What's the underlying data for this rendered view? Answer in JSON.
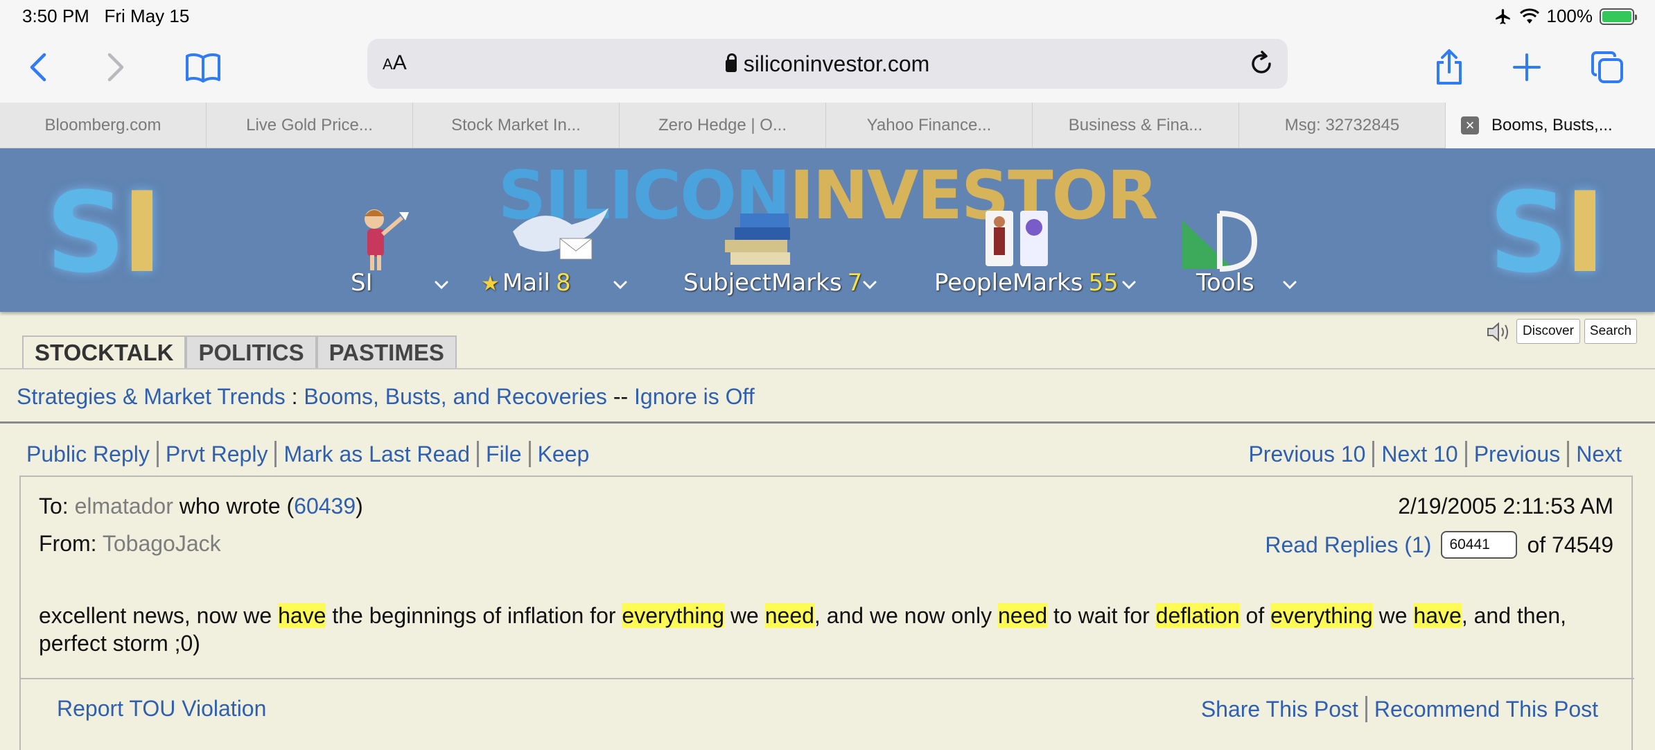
{
  "status_bar": {
    "time": "3:50 PM",
    "date": "Fri May 15",
    "battery": "100%"
  },
  "browser": {
    "url": "siliconinvestor.com",
    "reader_label_small": "A",
    "reader_label_large": "A",
    "tabs": [
      "Bloomberg.com",
      "Live Gold Price...",
      "Stock Market In...",
      "Zero Hedge | O...",
      "Yahoo Finance...",
      "Business & Fina...",
      "Msg: 32732845",
      "Booms, Busts,..."
    ]
  },
  "banner": {
    "logo_s": "S",
    "logo_i": "I",
    "brand_part1": "SILICON",
    "brand_part2": "INVESTOR",
    "menu": {
      "si": "SI",
      "mail": "Mail",
      "mail_count": "8",
      "subjectmarks": "SubjectMarks",
      "subjectmarks_count": "7",
      "peoplemarks": "PeopleMarks",
      "peoplemarks_count": "55",
      "tools": "Tools"
    }
  },
  "utility": {
    "discover": "Discover",
    "search": "Search"
  },
  "sections": {
    "stocktalk": "STOCKTALK",
    "politics": "POLITICS",
    "pastimes": "PASTIMES"
  },
  "breadcrumb": {
    "parent": "Strategies & Market Trends",
    "colon": " : ",
    "thread": "Booms, Busts, and Recoveries",
    "dash": " -- ",
    "ignore": "Ignore is Off"
  },
  "actions": {
    "public_reply": "Public Reply",
    "private_reply": "Prvt Reply",
    "mark_last_read": "Mark as Last Read",
    "file": "File",
    "keep": "Keep",
    "prev10": "Previous 10",
    "next10": "Next 10",
    "previous": "Previous",
    "next": "Next"
  },
  "message": {
    "to_label": "To:",
    "to_user": "elmatador",
    "wrote_label": " who wrote (",
    "ref_msg": "60439",
    "close_paren": ")",
    "from_label": "From:",
    "from_user": "TobagoJack",
    "date": "2/19/2005 2:11:53 AM",
    "read_replies": "Read Replies (1)",
    "msg_number": "60441",
    "of_total": "of 74549",
    "body": [
      {
        "t": "excellent news, now we ",
        "h": false
      },
      {
        "t": "have",
        "h": true
      },
      {
        "t": " the beginnings of inflation for ",
        "h": false
      },
      {
        "t": "everything",
        "h": true
      },
      {
        "t": " we ",
        "h": false
      },
      {
        "t": "need",
        "h": true
      },
      {
        "t": ", and we now only ",
        "h": false
      },
      {
        "t": "need",
        "h": true
      },
      {
        "t": " to wait for ",
        "h": false
      },
      {
        "t": "deflation",
        "h": true
      },
      {
        "t": " of ",
        "h": false
      },
      {
        "t": "everything",
        "h": true
      },
      {
        "t": " we ",
        "h": false
      },
      {
        "t": "have",
        "h": true
      },
      {
        "t": ", and then, perfect storm ;0)",
        "h": false
      }
    ],
    "report": "Report TOU Violation",
    "share": "Share This Post",
    "recommend": "Recommend This Post"
  },
  "colors": {
    "banner": "#6184b2",
    "link": "#2f5fb0",
    "highlight": "#fffb55",
    "page_bg": "#f1f0df"
  }
}
